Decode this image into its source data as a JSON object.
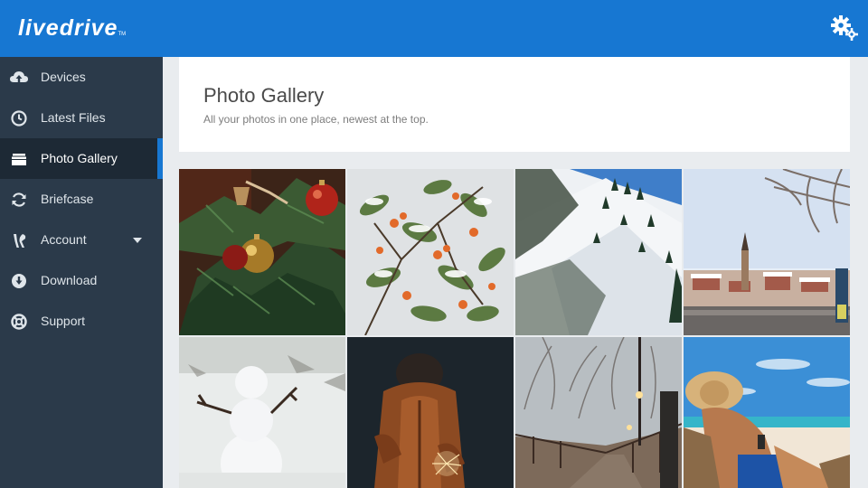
{
  "app": {
    "logo_text": "livedrive",
    "logo_tm": "TM"
  },
  "header": {
    "settings_icon": "gear-icon"
  },
  "sidebar": {
    "items": [
      {
        "label": "Devices",
        "icon": "cloud-upload-icon"
      },
      {
        "label": "Latest Files",
        "icon": "clock-icon"
      },
      {
        "label": "Photo Gallery",
        "icon": "gallery-icon",
        "active": true
      },
      {
        "label": "Briefcase",
        "icon": "sync-icon"
      },
      {
        "label": "Account",
        "icon": "tools-icon",
        "has_dropdown": true
      },
      {
        "label": "Download",
        "icon": "download-icon"
      },
      {
        "label": "Support",
        "icon": "lifebuoy-icon"
      }
    ]
  },
  "main": {
    "title": "Photo Gallery",
    "subtitle": "All your photos in one place, newest at the top."
  },
  "gallery": {
    "photos": [
      {
        "subject": "christmas-ornaments"
      },
      {
        "subject": "snowy-berries"
      },
      {
        "subject": "snowy-hillside"
      },
      {
        "subject": "winter-town"
      },
      {
        "subject": "snowman"
      },
      {
        "subject": "child-with-sparkler"
      },
      {
        "subject": "winter-bridge"
      },
      {
        "subject": "beach-reader"
      }
    ]
  },
  "colors": {
    "brand_blue": "#1777d2",
    "sidebar_bg": "#2b3a4a",
    "sidebar_active": "#1d2935"
  }
}
